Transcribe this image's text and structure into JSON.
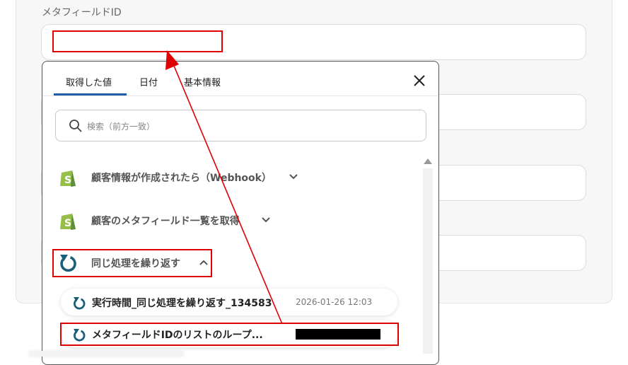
{
  "form": {
    "metafield_label": "メタフィールドID"
  },
  "picker": {
    "tabs": [
      {
        "label": "取得した値",
        "active": true
      },
      {
        "label": "日付",
        "active": false
      },
      {
        "label": "基本情報",
        "active": false
      }
    ],
    "search_placeholder": "検索（前方一致）",
    "groups": [
      {
        "label": "顧客情報が作成されたら（Webhook）",
        "icon": "shopify-icon",
        "expanded": false
      },
      {
        "label": "顧客のメタフィールド一覧を取得",
        "icon": "shopify-icon",
        "expanded": false
      },
      {
        "label": "同じ処理を繰り返す",
        "icon": "loop-icon",
        "expanded": true
      }
    ],
    "items": [
      {
        "label": "実行時間_同じ処理を繰り返す_134583",
        "value": "2026-01-26 12:03",
        "icon": "loop-icon"
      },
      {
        "label": "メタフィールドIDのリストのループ...",
        "value": "",
        "icon": "loop-icon",
        "redacted": true
      }
    ]
  },
  "colors": {
    "accent": "#1e5fa8",
    "highlight": "#e00000",
    "shopify_green": "#95bf47",
    "loop_icon": "#1b5e7a"
  }
}
